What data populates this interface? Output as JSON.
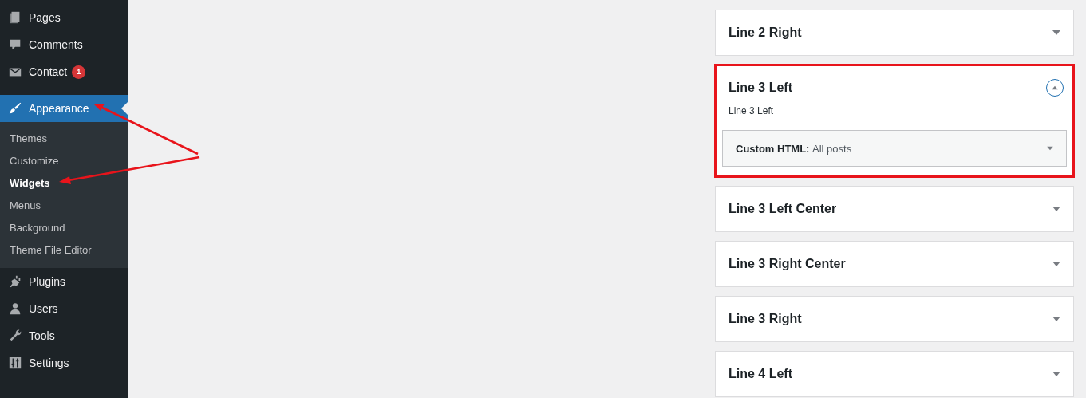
{
  "sidebar": {
    "items": [
      {
        "label": "Pages",
        "selected": false
      },
      {
        "label": "Comments",
        "selected": false
      },
      {
        "label": "Contact",
        "selected": false,
        "badge": "1"
      },
      {
        "label": "Appearance",
        "selected": true,
        "children": [
          {
            "label": "Themes",
            "selected": false
          },
          {
            "label": "Customize",
            "selected": false
          },
          {
            "label": "Widgets",
            "selected": true
          },
          {
            "label": "Menus",
            "selected": false
          },
          {
            "label": "Background",
            "selected": false
          },
          {
            "label": "Theme File Editor",
            "selected": false
          }
        ]
      },
      {
        "label": "Plugins",
        "selected": false
      },
      {
        "label": "Users",
        "selected": false
      },
      {
        "label": "Tools",
        "selected": false
      },
      {
        "label": "Settings",
        "selected": false
      }
    ]
  },
  "widget_areas": [
    {
      "title": "Line 2 Right",
      "expanded": false,
      "highlighted": false
    },
    {
      "title": "Line 3 Left",
      "expanded": true,
      "highlighted": true,
      "description": "Line 3 Left",
      "widgets": [
        {
          "title": "Custom HTML:",
          "in_widget_title": "All posts",
          "expanded": false
        }
      ]
    },
    {
      "title": "Line 3 Left Center",
      "expanded": false,
      "highlighted": false
    },
    {
      "title": "Line 3 Right Center",
      "expanded": false,
      "highlighted": false
    },
    {
      "title": "Line 3 Right",
      "expanded": false,
      "highlighted": false
    },
    {
      "title": "Line 4 Left",
      "expanded": false,
      "highlighted": false
    }
  ]
}
